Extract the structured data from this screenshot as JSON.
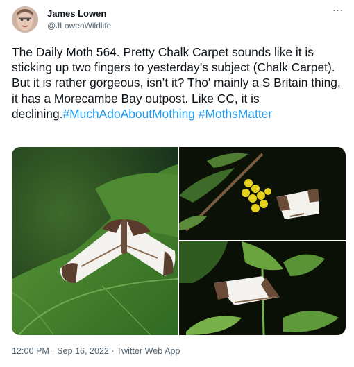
{
  "author": {
    "display_name": "James Lowen",
    "handle": "@JLowenWildlife",
    "avatar_icon": "profile-photo"
  },
  "menu": {
    "more_label": "···"
  },
  "tweet": {
    "text": "The Daily Moth 564. Pretty Chalk Carpet sounds like it is sticking up two fingers to yesterday’s subject (Chalk Carpet). But it is rather gorgeous, isn’t it? Tho' mainly a S Britain thing, it has a Morecambe Bay outpost. Like CC, it is declining.",
    "hashtags": [
      "#MuchAdoAboutMothing",
      "#MothsMatter"
    ]
  },
  "meta": {
    "time": "12:00 PM",
    "separator": "·",
    "date": "Sep 16, 2022",
    "source": "Twitter Web App"
  },
  "colors": {
    "link": "#1d9bf0",
    "text": "#0f1419",
    "secondary": "#536471"
  }
}
